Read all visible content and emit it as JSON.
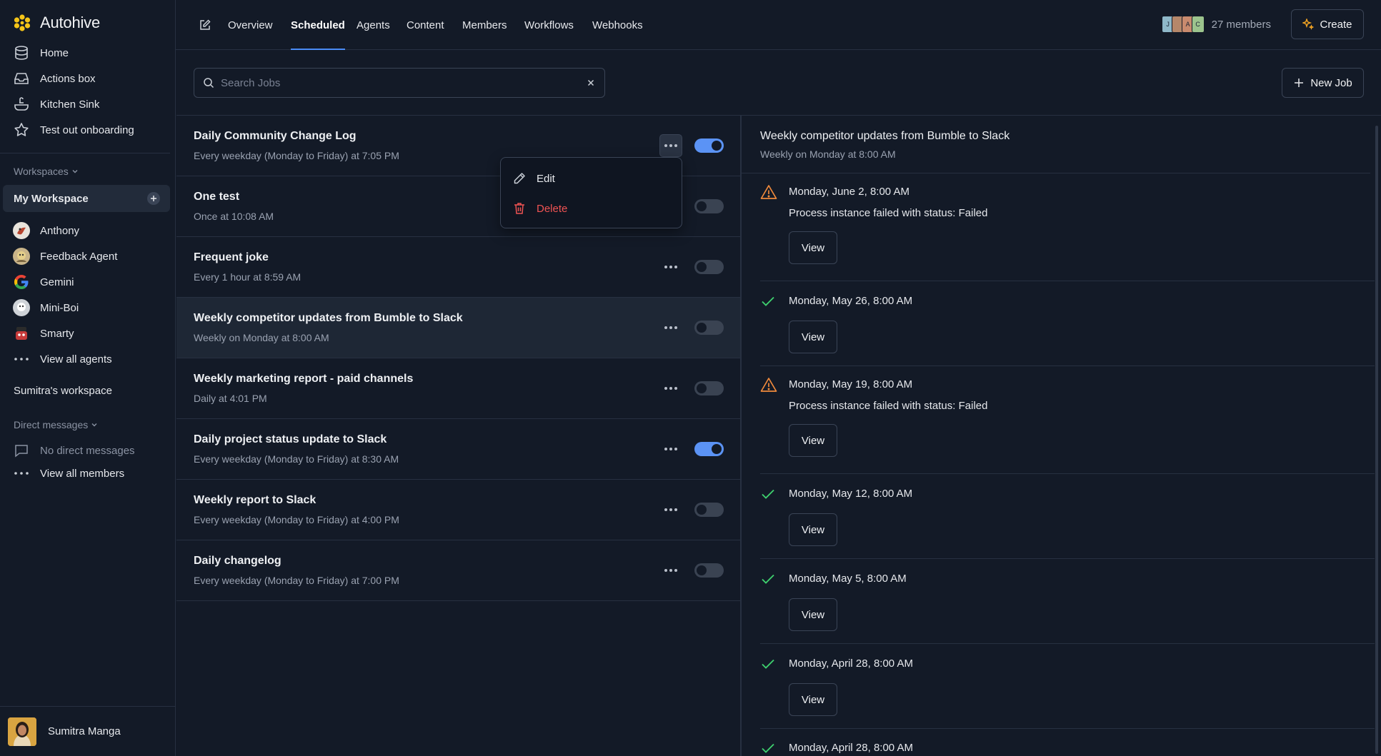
{
  "app": {
    "name": "Autohive"
  },
  "sidebar": {
    "nav": [
      {
        "label": "Home",
        "icon": "database-icon"
      },
      {
        "label": "Actions box",
        "icon": "inbox-icon"
      },
      {
        "label": "Kitchen Sink",
        "icon": "sink-icon"
      },
      {
        "label": "Test out onboarding",
        "icon": "star-icon"
      }
    ],
    "workspaces_label": "Workspaces",
    "active_workspace": "My Workspace",
    "agents": [
      {
        "label": "Anthony"
      },
      {
        "label": "Feedback Agent"
      },
      {
        "label": "Gemini"
      },
      {
        "label": "Mini-Boi"
      },
      {
        "label": "Smarty"
      }
    ],
    "view_all_agents": "View all agents",
    "other_workspace": "Sumitra's workspace",
    "dm_label": "Direct messages",
    "no_dm": "No direct messages",
    "view_all_members": "View all members",
    "user_name": "Sumitra Manga"
  },
  "topnav": {
    "tabs": [
      "Overview",
      "Scheduled",
      "Agents",
      "Content",
      "Members",
      "Workflows",
      "Webhooks"
    ],
    "active_tab": "Scheduled",
    "member_initials": [
      "J",
      "",
      "A",
      "C"
    ],
    "members_count": "27 members",
    "create_label": "Create"
  },
  "search": {
    "placeholder": "Search Jobs",
    "value": ""
  },
  "new_job_label": "New Job",
  "jobs": [
    {
      "title": "Daily Community Change Log",
      "schedule": "Every weekday (Monday to Friday) at 7:05 PM",
      "enabled": true
    },
    {
      "title": "One test",
      "schedule": "Once at 10:08 AM",
      "enabled": false
    },
    {
      "title": "Frequent joke",
      "schedule": "Every 1 hour at 8:59 AM",
      "enabled": false
    },
    {
      "title": "Weekly competitor updates from Bumble to Slack",
      "schedule": "Weekly on Monday at 8:00 AM",
      "enabled": false,
      "selected": true
    },
    {
      "title": "Weekly marketing report - paid channels",
      "schedule": "Daily at 4:01 PM",
      "enabled": false
    },
    {
      "title": "Daily project status update to Slack",
      "schedule": "Every weekday (Monday to Friday) at 8:30 AM",
      "enabled": true
    },
    {
      "title": "Weekly report to Slack",
      "schedule": "Every weekday (Monday to Friday) at 4:00 PM",
      "enabled": false
    },
    {
      "title": "Daily changelog",
      "schedule": "Every weekday (Monday to Friday) at 7:00 PM",
      "enabled": false
    }
  ],
  "menu": {
    "edit": "Edit",
    "delete": "Delete"
  },
  "detail": {
    "title": "Weekly competitor updates from Bumble to Slack",
    "schedule": "Weekly on Monday at 8:00 AM",
    "view_label": "View",
    "runs": [
      {
        "date": "Monday, June 2, 8:00 AM",
        "status": "failed",
        "message": "Process instance failed with status: Failed"
      },
      {
        "date": "Monday, May 26, 8:00 AM",
        "status": "success"
      },
      {
        "date": "Monday, May 19, 8:00 AM",
        "status": "failed",
        "message": "Process instance failed with status: Failed"
      },
      {
        "date": "Monday, May 12, 8:00 AM",
        "status": "success"
      },
      {
        "date": "Monday, May 5, 8:00 AM",
        "status": "success"
      },
      {
        "date": "Monday, April 28, 8:00 AM",
        "status": "success"
      },
      {
        "date": "Monday, April 28, 8:00 AM",
        "status": "success"
      }
    ]
  },
  "colors": {
    "accent": "#4a8cf7",
    "toggle_on": "#5b93f5",
    "success": "#3ecf6e",
    "warning": "#f08a3c",
    "danger": "#ef5353",
    "brand": "#f5c518"
  }
}
